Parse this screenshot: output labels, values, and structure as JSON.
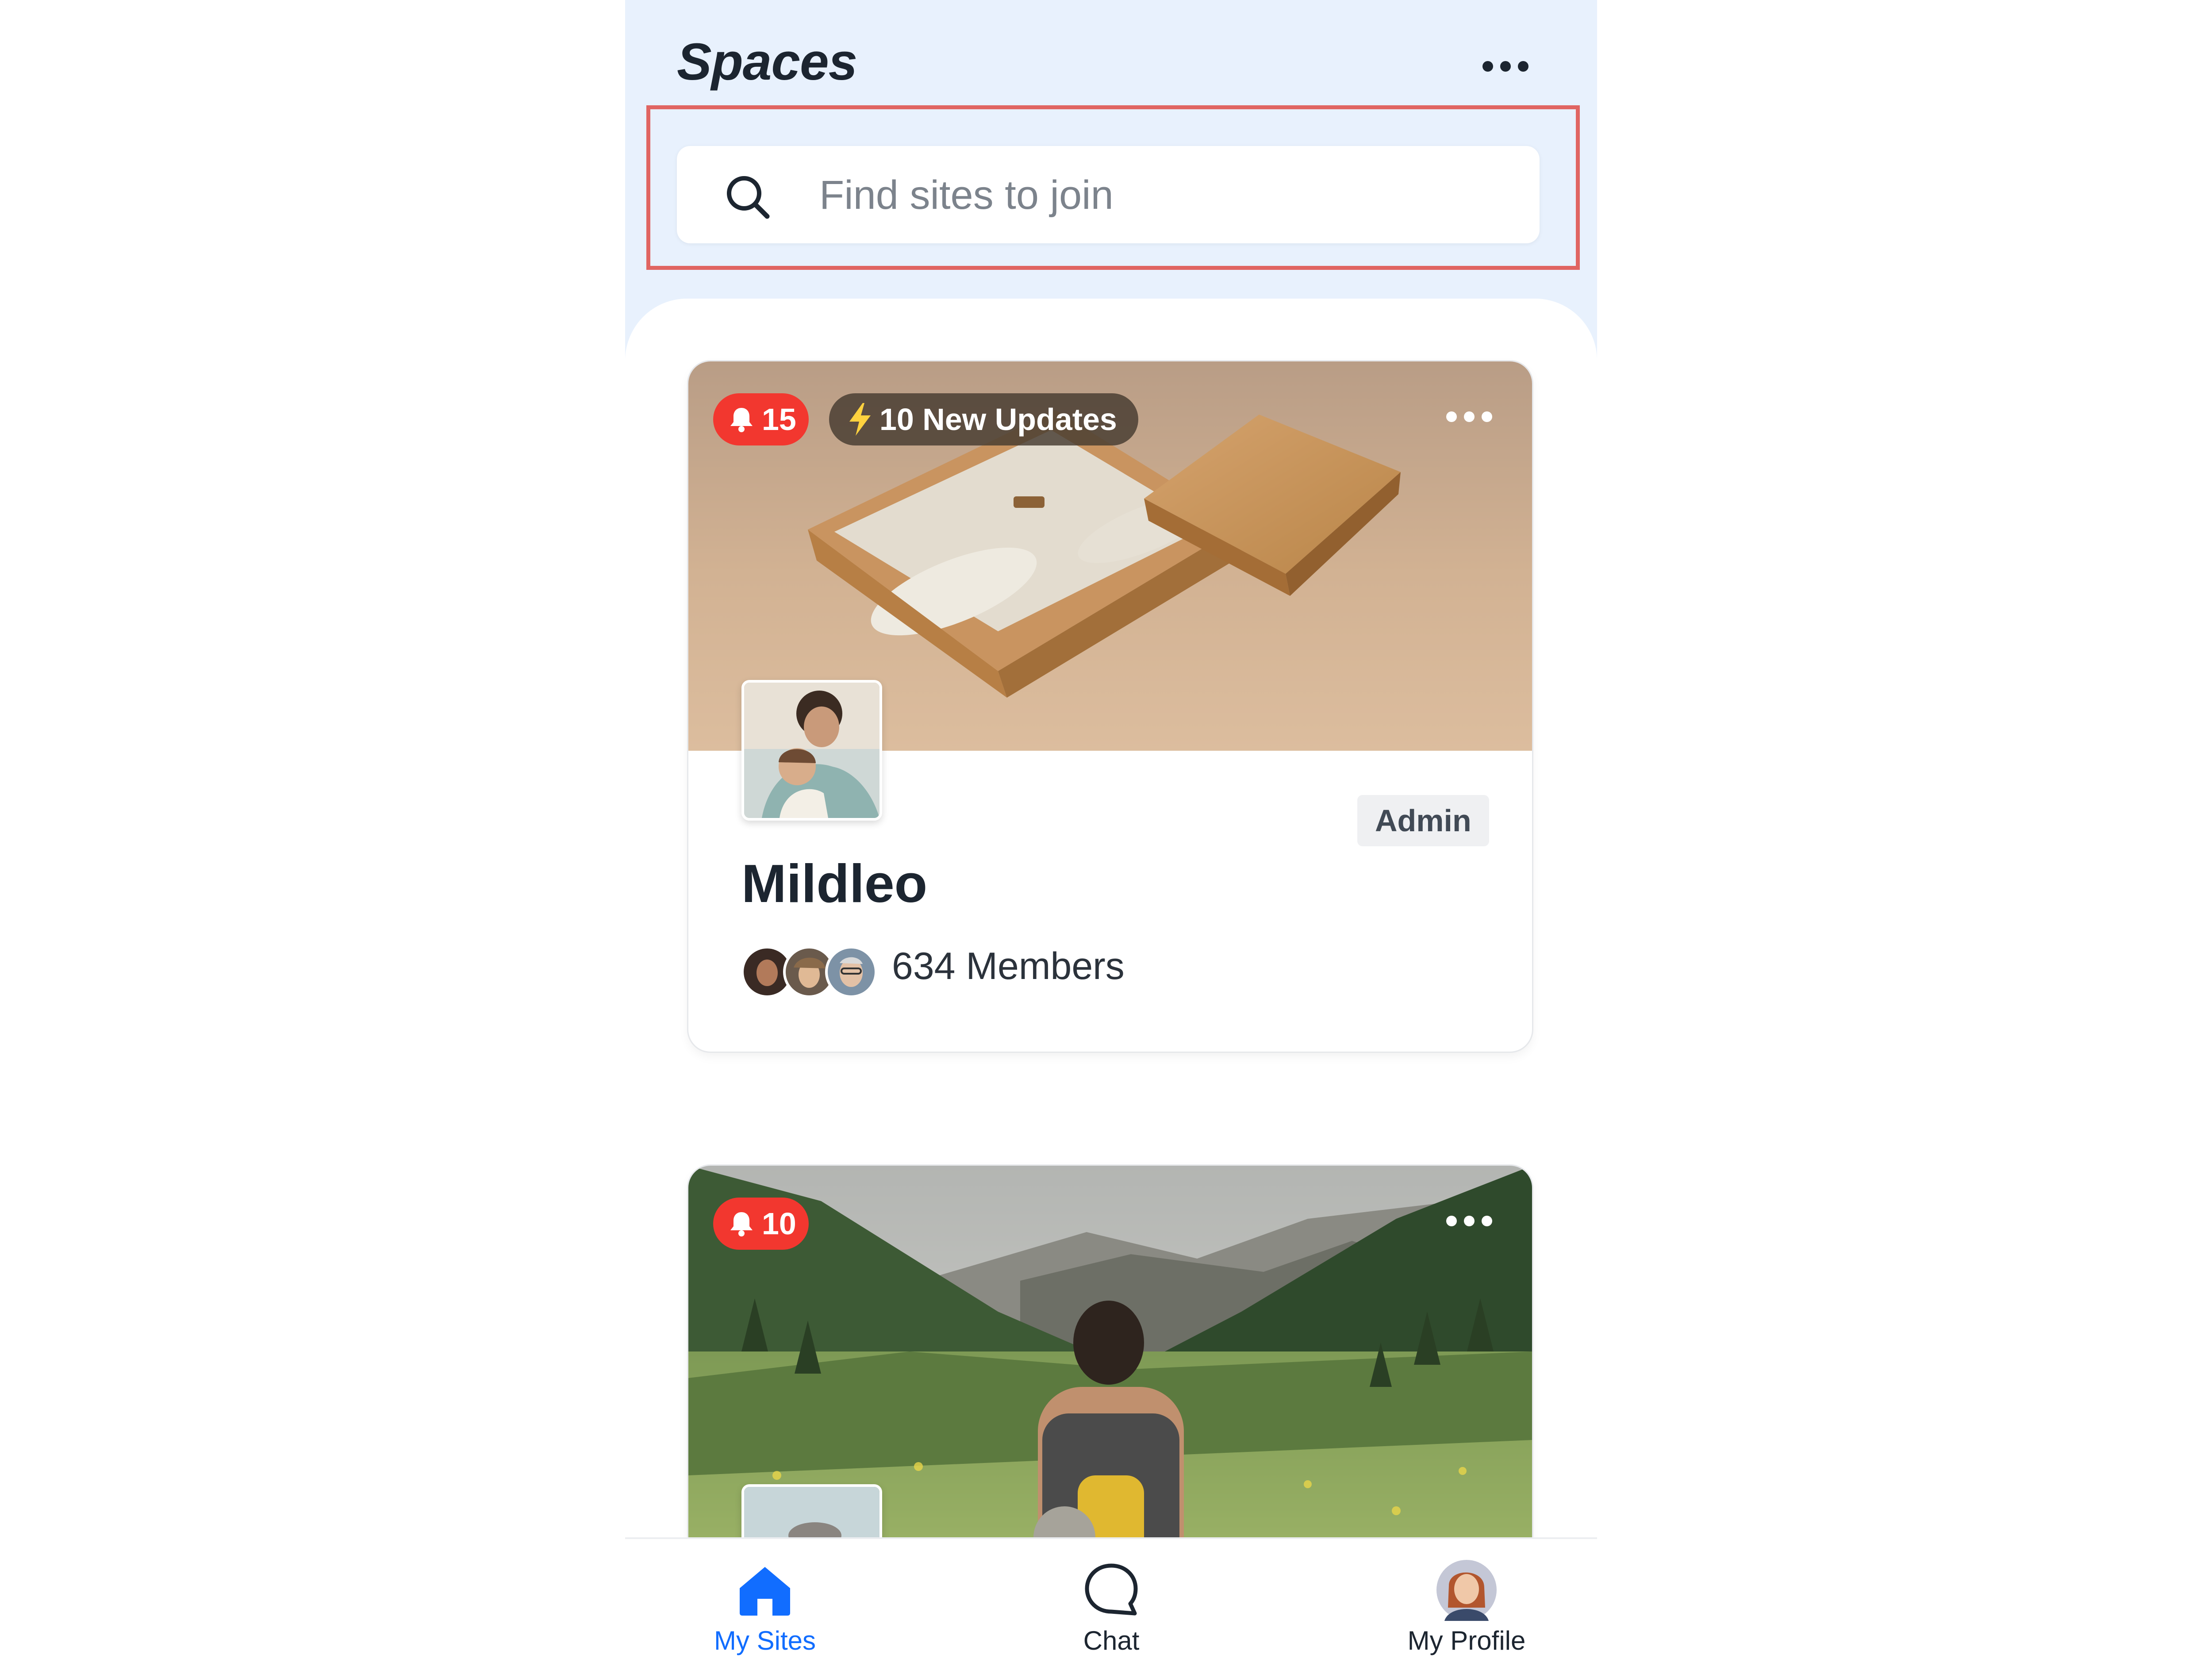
{
  "header": {
    "title": "Spaces",
    "more_icon": "more-horizontal-icon"
  },
  "search": {
    "placeholder": "Find sites to join",
    "value": "",
    "icon": "search-icon"
  },
  "sites": [
    {
      "name": "Mildleo",
      "notification_count": "15",
      "updates_label": "10 New Updates",
      "role": "Admin",
      "members_label": "634 Members",
      "cover": "product-boxes-photo"
    },
    {
      "notification_count": "10",
      "cover": "hiker-in-valley-photo"
    }
  ],
  "bottom_nav": {
    "items": [
      {
        "label": "My Sites",
        "icon": "home-icon",
        "active": true
      },
      {
        "label": "Chat",
        "icon": "chat-icon",
        "active": false
      },
      {
        "label": "My Profile",
        "icon": "profile-avatar",
        "active": false
      }
    ]
  },
  "colors": {
    "header_bg": "#e8f1fd",
    "accent": "#116dff",
    "notification": "#f2372f",
    "highlight_border": "#e06562"
  }
}
